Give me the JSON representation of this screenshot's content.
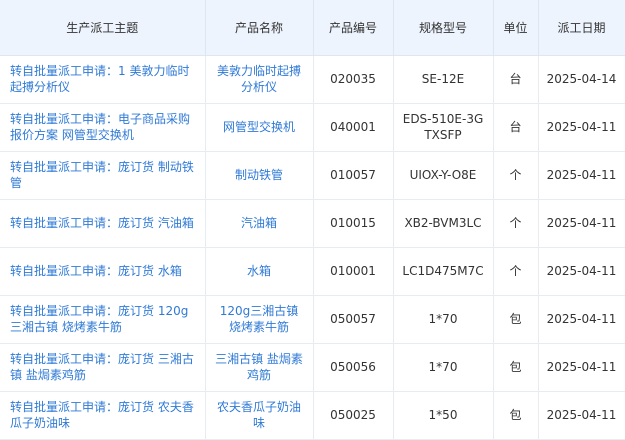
{
  "table": {
    "columns": [
      "生产派工主题",
      "产品名称",
      "产品编号",
      "规格型号",
      "单位",
      "派工日期"
    ],
    "rows": [
      {
        "subject": "转自批量派工申请：1 美敦力临时起搏分析仪",
        "product_name": "美敦力临时起搏分析仪",
        "code": "020035",
        "spec": "SE-12E",
        "unit": "台",
        "date": "2025-04-14"
      },
      {
        "subject": "转自批量派工申请：电子商品采购报价方案 网管型交换机",
        "product_name": "网管型交换机",
        "code": "040001",
        "spec": "EDS-510E-3GTXSFP",
        "unit": "台",
        "date": "2025-04-11"
      },
      {
        "subject": "转自批量派工申请：庞订货 制动铁管",
        "product_name": "制动铁管",
        "code": "010057",
        "spec": "UIOX-Y-O8E",
        "unit": "个",
        "date": "2025-04-11"
      },
      {
        "subject": "转自批量派工申请：庞订货 汽油箱",
        "product_name": "汽油箱",
        "code": "010015",
        "spec": "XB2-BVM3LC",
        "unit": "个",
        "date": "2025-04-11"
      },
      {
        "subject": "转自批量派工申请：庞订货 水箱",
        "product_name": "水箱",
        "code": "010001",
        "spec": "LC1D475M7C",
        "unit": "个",
        "date": "2025-04-11"
      },
      {
        "subject": "转自批量派工申请：庞订货 120g三湘古镇 烧烤素牛筋",
        "product_name": "120g三湘古镇 烧烤素牛筋",
        "code": "050057",
        "spec": "1*70",
        "unit": "包",
        "date": "2025-04-11"
      },
      {
        "subject": "转自批量派工申请：庞订货 三湘古镇 盐焗素鸡筋",
        "product_name": "三湘古镇 盐焗素鸡筋",
        "code": "050056",
        "spec": "1*70",
        "unit": "包",
        "date": "2025-04-11"
      },
      {
        "subject": "转自批量派工申请：庞订货 农夫香瓜子奶油味",
        "product_name": "农夫香瓜子奶油味",
        "code": "050025",
        "spec": "1*50",
        "unit": "包",
        "date": "2025-04-11"
      }
    ]
  },
  "colors": {
    "link": "#2f7ad6",
    "header_bg": "#eef4fd",
    "border": "#e7ebf2"
  }
}
